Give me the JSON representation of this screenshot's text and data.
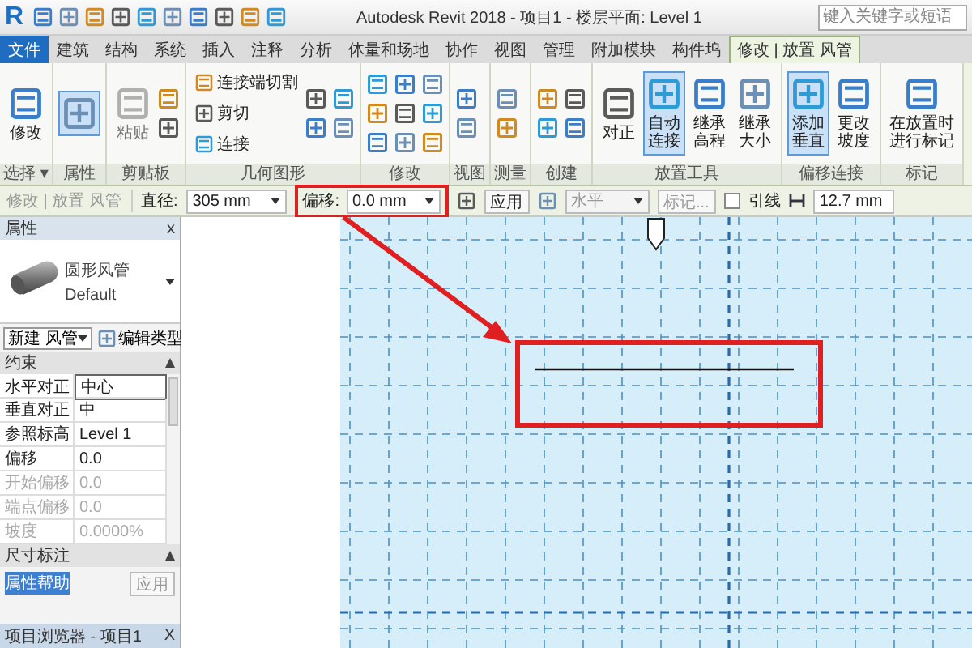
{
  "title_bar": {
    "logo": "R",
    "title": "Autodesk Revit 2018 -   项目1 - 楼层平面: Level 1",
    "search": {
      "placeholder": "键入关键字或短语"
    }
  },
  "ribbon_tabs": [
    {
      "label": "文件",
      "kind": "file",
      "selected": false
    },
    {
      "label": "建筑",
      "kind": "tab",
      "selected": false
    },
    {
      "label": "结构",
      "kind": "tab",
      "selected": false
    },
    {
      "label": "系统",
      "kind": "tab",
      "selected": false
    },
    {
      "label": "插入",
      "kind": "tab",
      "selected": false
    },
    {
      "label": "注释",
      "kind": "tab",
      "selected": false
    },
    {
      "label": "分析",
      "kind": "tab",
      "selected": false
    },
    {
      "label": "体量和场地",
      "kind": "tab",
      "selected": false
    },
    {
      "label": "协作",
      "kind": "tab",
      "selected": false
    },
    {
      "label": "视图",
      "kind": "tab",
      "selected": false
    },
    {
      "label": "管理",
      "kind": "tab",
      "selected": false
    },
    {
      "label": "附加模块",
      "kind": "tab",
      "selected": false
    },
    {
      "label": "构件坞",
      "kind": "tab",
      "selected": false
    },
    {
      "label": "修改 | 放置 风管",
      "kind": "tab",
      "selected": true
    }
  ],
  "ribbon_panels": [
    {
      "label": "选择 ▾",
      "tools": [
        {
          "kind": "large",
          "label": "修改",
          "selected": false,
          "disabled": false
        }
      ]
    },
    {
      "label": "属性",
      "tools": [
        {
          "kind": "large",
          "selected": true,
          "disabled": false
        }
      ]
    },
    {
      "label": "剪贴板",
      "tools": [
        {
          "kind": "large",
          "label": "粘贴",
          "selected": false,
          "disabled": true
        }
      ]
    },
    {
      "label": "几何图形",
      "tools": [
        {
          "kind": "small",
          "label": "连接端切割",
          "selected": false,
          "disabled": false
        },
        {
          "kind": "small",
          "label": "剪切",
          "selected": false,
          "disabled": false
        },
        {
          "kind": "small",
          "label": "连接",
          "selected": false,
          "disabled": false
        }
      ]
    },
    {
      "label": "修改"
    },
    {
      "label": "视图"
    },
    {
      "label": "测量"
    },
    {
      "label": "创建"
    },
    {
      "label": "放置工具",
      "tools": [
        {
          "kind": "large",
          "label": "对正",
          "selected": false,
          "disabled": false
        },
        {
          "kind": "large",
          "label": "自动连接",
          "selected": true,
          "disabled": false
        },
        {
          "kind": "large",
          "label": "继承高程",
          "selected": false,
          "disabled": false
        },
        {
          "kind": "large",
          "label": "继承大小",
          "selected": false,
          "disabled": false
        }
      ]
    },
    {
      "label": "偏移连接",
      "tools": [
        {
          "kind": "large",
          "label": "添加垂直",
          "selected": true,
          "disabled": false
        },
        {
          "kind": "large",
          "label": "更改坡度",
          "selected": false,
          "disabled": false
        }
      ]
    },
    {
      "label": "标记",
      "tools": [
        {
          "kind": "large",
          "label": "在放置时进行标记",
          "selected": false,
          "disabled": false
        }
      ]
    }
  ],
  "options_bar": {
    "context": "修改 | 放置 风管",
    "diameter": {
      "label": "直径:",
      "value": "305 mm"
    },
    "offset": {
      "label": "偏移:",
      "value": "0.0 mm"
    },
    "apply_button": "应用",
    "justification": {
      "value": "水平",
      "disabled": true
    },
    "tag_button": {
      "label": "标记...",
      "disabled": true
    },
    "leader": {
      "label": "引线",
      "checked": false
    },
    "length": {
      "value": "12.7 mm"
    }
  },
  "properties": {
    "title": "属性",
    "close": "x",
    "type_name": "圆形风管",
    "type_sub": "Default",
    "instance_selector": "新建 风管",
    "edit_type": "编辑类型",
    "sections": [
      {
        "title": "约束",
        "rows": [
          {
            "label": "水平对正",
            "value": "中心",
            "editing": true,
            "disabled": false
          },
          {
            "label": "垂直对正",
            "value": "中",
            "editing": false,
            "disabled": false
          },
          {
            "label": "参照标高",
            "value": "Level 1",
            "editing": false,
            "disabled": false
          },
          {
            "label": "偏移",
            "value": "0.0",
            "editing": false,
            "disabled": false
          },
          {
            "label": "开始偏移",
            "value": "0.0",
            "editing": false,
            "disabled": true
          },
          {
            "label": "端点偏移",
            "value": "0.0",
            "editing": false,
            "disabled": true
          },
          {
            "label": "坡度",
            "value": "0.0000%",
            "editing": false,
            "disabled": true
          }
        ]
      },
      {
        "title": "尺寸标注"
      }
    ],
    "help_link": "属性帮助",
    "apply_button": {
      "label": "应用",
      "disabled": true
    }
  },
  "project_browser": {
    "title": "项目浏览器 - 项目1",
    "close": "X"
  }
}
